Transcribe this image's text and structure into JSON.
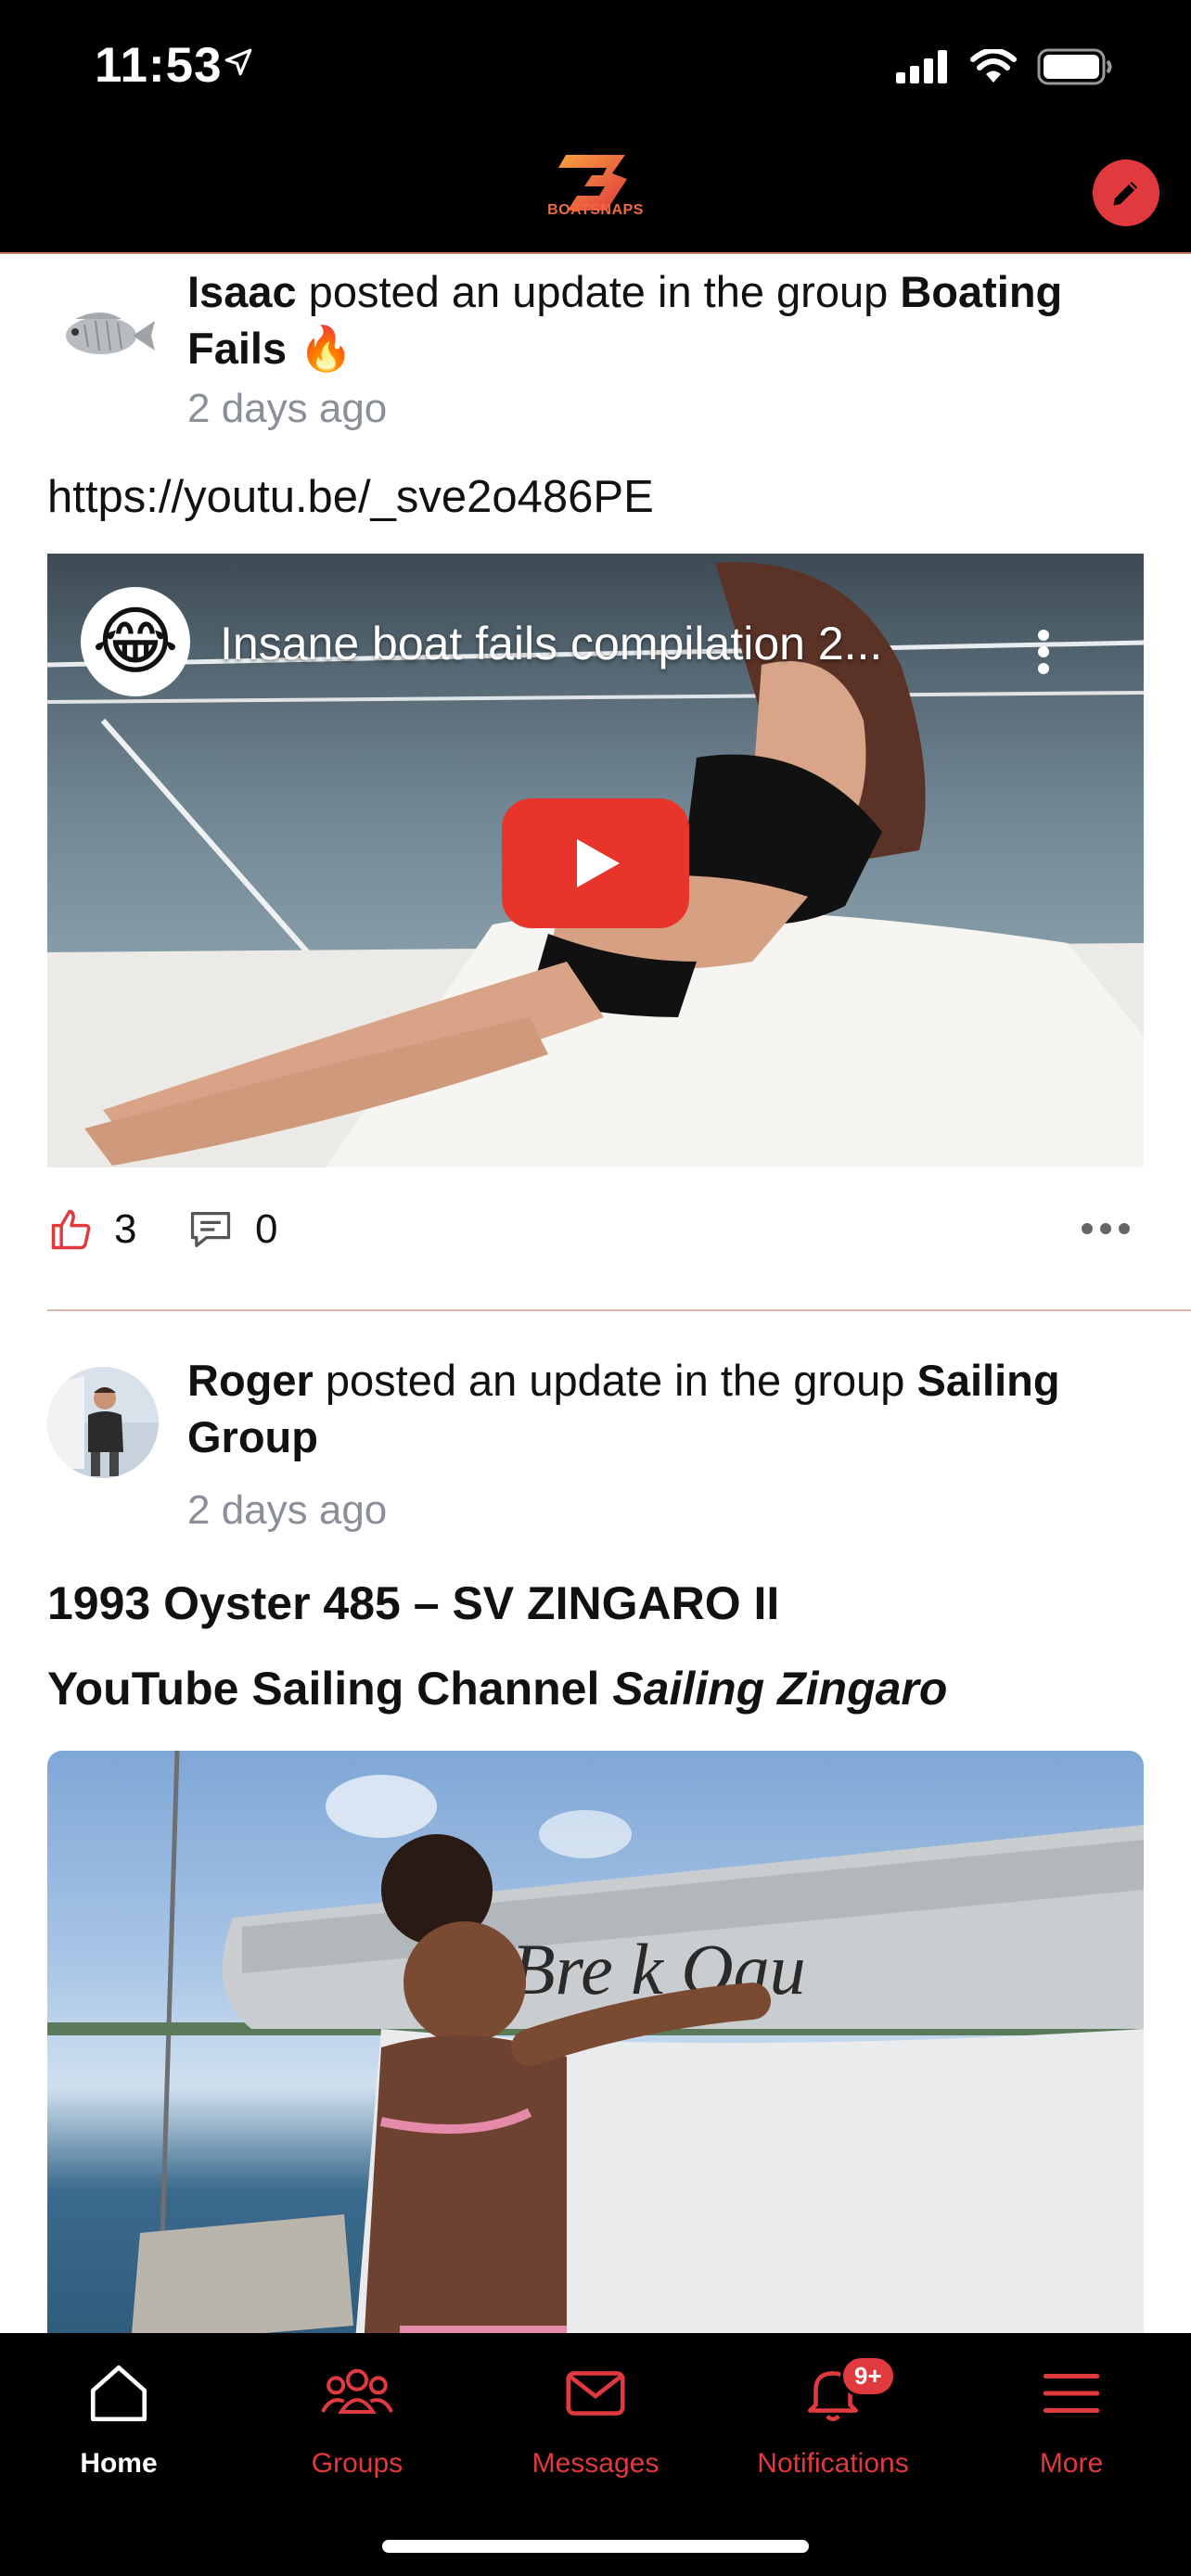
{
  "status_bar": {
    "time": "11:53"
  },
  "header": {
    "logo_text": "BOATSNAPS",
    "compose_icon": "pencil-icon"
  },
  "posts": [
    {
      "author": "Isaac",
      "action": " posted an update in the group ",
      "group": "Boating Fails",
      "group_emoji": "🔥",
      "time": "2 days ago",
      "text": "https://youtu.be/_sve2o486PE",
      "video": {
        "title": "Insane boat fails compilation 2...",
        "channel_emoji": "😂"
      },
      "likes": "3",
      "comments": "0"
    },
    {
      "author": "Roger",
      "action": " posted an update in the group ",
      "group": "Sailing Group",
      "time": "2 days ago",
      "title_line1": "1993 Oyster 485 – SV ZINGARO II",
      "title_line2_plain": "YouTube Sailing Channel ",
      "title_line2_italic": "Sailing Zingaro",
      "image_text": "Bre k  Oau"
    }
  ],
  "tabbar": {
    "items": [
      {
        "label": "Home",
        "icon": "home-icon"
      },
      {
        "label": "Groups",
        "icon": "groups-icon"
      },
      {
        "label": "Messages",
        "icon": "messages-icon"
      },
      {
        "label": "Notifications",
        "icon": "bell-icon",
        "badge": "9+"
      },
      {
        "label": "More",
        "icon": "menu-icon"
      }
    ]
  },
  "colors": {
    "accent": "#e0393e",
    "muted": "#8a8f98",
    "bar": "#000000"
  }
}
